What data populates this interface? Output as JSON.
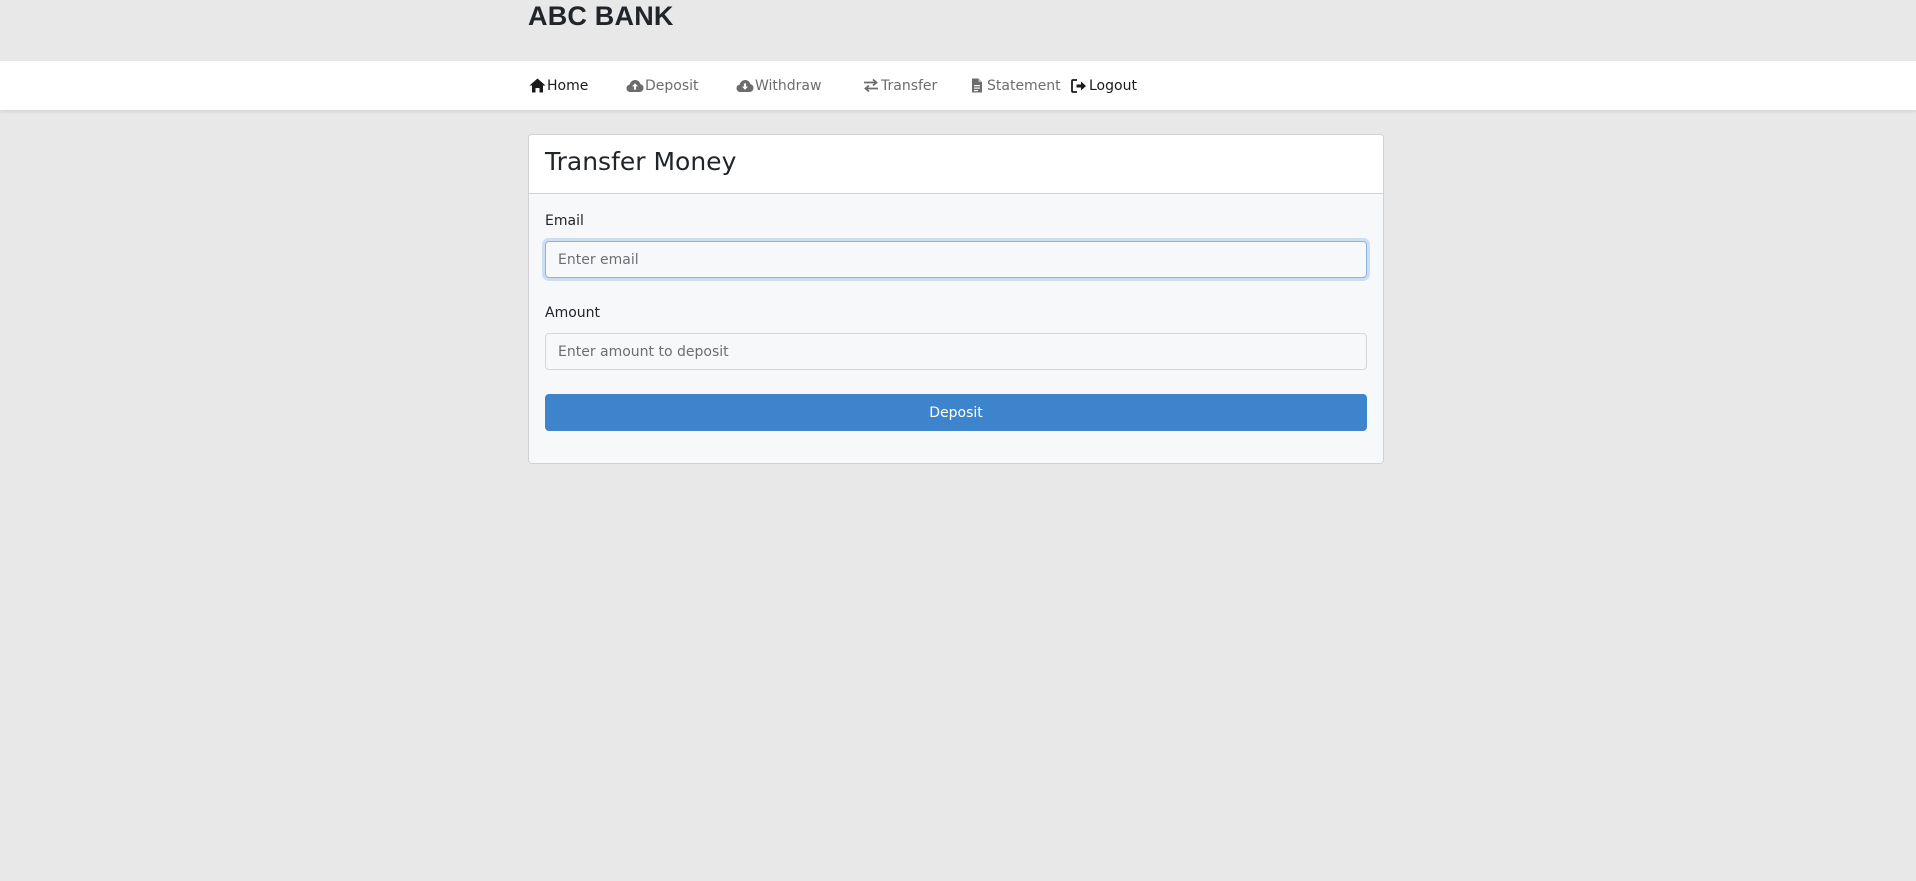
{
  "brand": {
    "title": "ABC BANK"
  },
  "nav": {
    "items": [
      {
        "label": "Home",
        "icon": "home-icon"
      },
      {
        "label": "Deposit",
        "icon": "cloud-upload-icon"
      },
      {
        "label": "Withdraw",
        "icon": "cloud-download-icon"
      },
      {
        "label": "Transfer",
        "icon": "transfer-arrows-icon"
      },
      {
        "label": "Statement",
        "icon": "document-icon"
      },
      {
        "label": "Logout",
        "icon": "logout-icon"
      }
    ]
  },
  "form": {
    "title": "Transfer Money",
    "email": {
      "label": "Email",
      "placeholder": "Enter email",
      "value": ""
    },
    "amount": {
      "label": "Amount",
      "placeholder": "Enter amount to deposit",
      "value": ""
    },
    "submit_label": "Deposit"
  },
  "colors": {
    "page_background": "#e8e8e8",
    "primary_button": "#3d84cc",
    "focus_ring": "#8db3e6"
  }
}
